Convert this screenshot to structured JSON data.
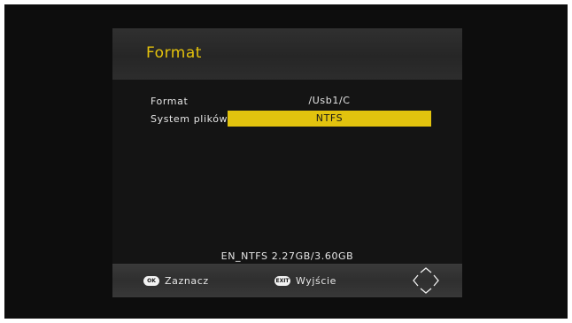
{
  "dialog": {
    "title": "Format",
    "rows": [
      {
        "label": "Format",
        "value": "/Usb1/C"
      },
      {
        "label": "System plików",
        "value": "NTFS"
      }
    ],
    "usage": "EN_NTFS  2.27GB/3.60GB"
  },
  "footer": {
    "ok_key": "OK",
    "ok_label": "Zaznacz",
    "exit_key": "EXIT",
    "exit_label": "Wyjście",
    "nav_icon": "directional-arrows-icon"
  },
  "colors": {
    "accent": "#e2c30e",
    "title_text": "#e4c20c",
    "background": "#0d0d0d"
  }
}
